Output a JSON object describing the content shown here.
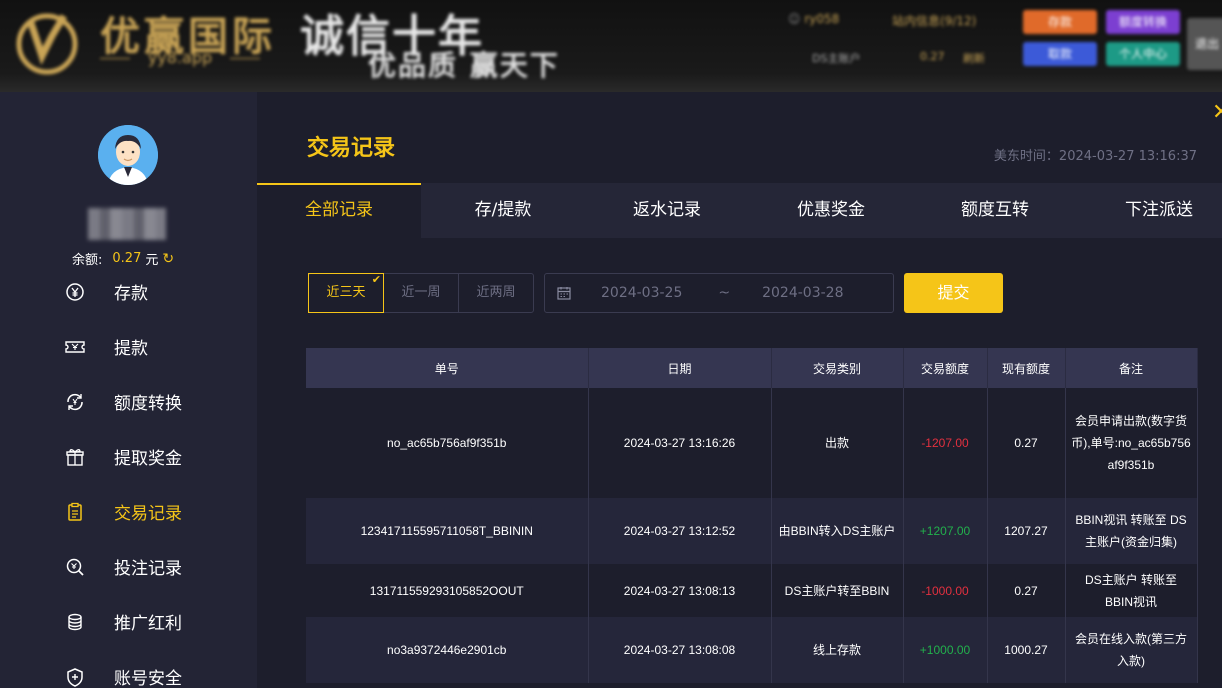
{
  "header": {
    "logo_text": "优赢国际",
    "logo_url": "yy8.app",
    "slogan_main": "诚信十年",
    "slogan_sub": "优品质 赢天下",
    "user": "ry058",
    "messages": "站内信息(9/12)",
    "account_label": "DS主账户",
    "account_amount": "0.27",
    "refresh_label": "刷新",
    "btn_deposit": "存款",
    "btn_transfer": "额度转换",
    "btn_withdraw": "取款",
    "btn_center": "个人中心",
    "btn_extra": "退出"
  },
  "sidebar": {
    "balance_label": "余额:",
    "balance_value": "0.27",
    "balance_unit": "元",
    "items": [
      {
        "label": "存款",
        "icon": "yuan-coin-icon"
      },
      {
        "label": "提款",
        "icon": "ticket-icon"
      },
      {
        "label": "额度转换",
        "icon": "cycle-yuan-icon"
      },
      {
        "label": "提取奖金",
        "icon": "gift-icon"
      },
      {
        "label": "交易记录",
        "icon": "clipboard-icon",
        "active": true
      },
      {
        "label": "投注记录",
        "icon": "search-doc-icon"
      },
      {
        "label": "推广红利",
        "icon": "coin-stack-icon"
      },
      {
        "label": "账号安全",
        "icon": "shield-icon"
      }
    ]
  },
  "main": {
    "title": "交易记录",
    "time_label": "美东时间：2024-03-27 13:16:37",
    "tabs": [
      "全部记录",
      "存/提款",
      "返水记录",
      "优惠奖金",
      "额度互转",
      "下注派送"
    ],
    "filter": {
      "chips": [
        "近三天",
        "近一周",
        "近两周"
      ],
      "start_date": "2024-03-25",
      "separator": "~",
      "end_date": "2024-03-28",
      "submit": "提交"
    },
    "table": {
      "headers": [
        "单号",
        "日期",
        "交易类别",
        "交易额度",
        "现有额度",
        "备注"
      ],
      "rows": [
        [
          "no_ac65b756af9f351b",
          "2024-03-27 13:16:26",
          "出款",
          "-1207.00",
          "0.27",
          "会员申请出款(数字货币),单号:no_ac65b756af9f351b"
        ],
        [
          "123417115595711058T_BBININ",
          "2024-03-27 13:12:52",
          "由BBIN转入DS主账户",
          "+1207.00",
          "1207.27",
          "BBIN视讯 转账至 DS主账户(资金归集)"
        ],
        [
          "131711559293105852OOUT",
          "2024-03-27 13:08:13",
          "DS主账户转至BBIN",
          "-1000.00",
          "0.27",
          "DS主账户 转账至 BBIN视讯"
        ],
        [
          "no3a9372446e2901cb",
          "2024-03-27 13:08:08",
          "线上存款",
          "+1000.00",
          "1000.27",
          "会员在线入款(第三方入款)"
        ]
      ]
    }
  },
  "colors": {
    "accent": "#f5c518",
    "negative": "#e2303f",
    "positive": "#22b04c",
    "sidebar_bg": "#232435",
    "main_bg": "#1d1e2c",
    "table_header_bg": "#353651"
  }
}
